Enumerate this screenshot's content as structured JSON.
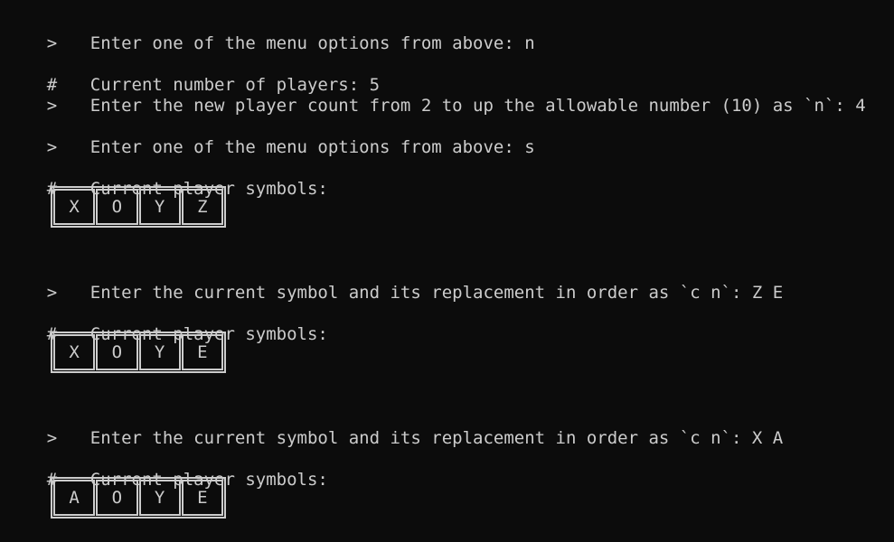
{
  "terminal": {
    "colors": {
      "background": "#0c0c0c",
      "foreground": "#cccccc"
    },
    "lines": [
      {
        "prefix": ">",
        "text": "Enter one of the menu options from above: n"
      },
      {
        "prefix": "#",
        "text": "Current number of players: 5"
      },
      {
        "prefix": ">",
        "text": "Enter the new player count from 2 to up the allowable number (10) as `n`: 4"
      },
      {
        "prefix": ">",
        "text": "Enter one of the menu options from above: s"
      },
      {
        "prefix": "#",
        "text": "Current player symbols:"
      },
      {
        "prefix": ">",
        "text": "Enter the current symbol and its replacement in order as `c n`: Z E"
      },
      {
        "prefix": "#",
        "text": "Current player symbols:"
      },
      {
        "prefix": ">",
        "text": "Enter the current symbol and its replacement in order as `c n`: X A"
      },
      {
        "prefix": "#",
        "text": "Current player symbols:"
      }
    ],
    "boards": [
      {
        "symbols": [
          "X",
          "O",
          "Y",
          "Z"
        ]
      },
      {
        "symbols": [
          "X",
          "O",
          "Y",
          "E"
        ]
      },
      {
        "symbols": [
          "A",
          "O",
          "Y",
          "E"
        ]
      }
    ]
  }
}
